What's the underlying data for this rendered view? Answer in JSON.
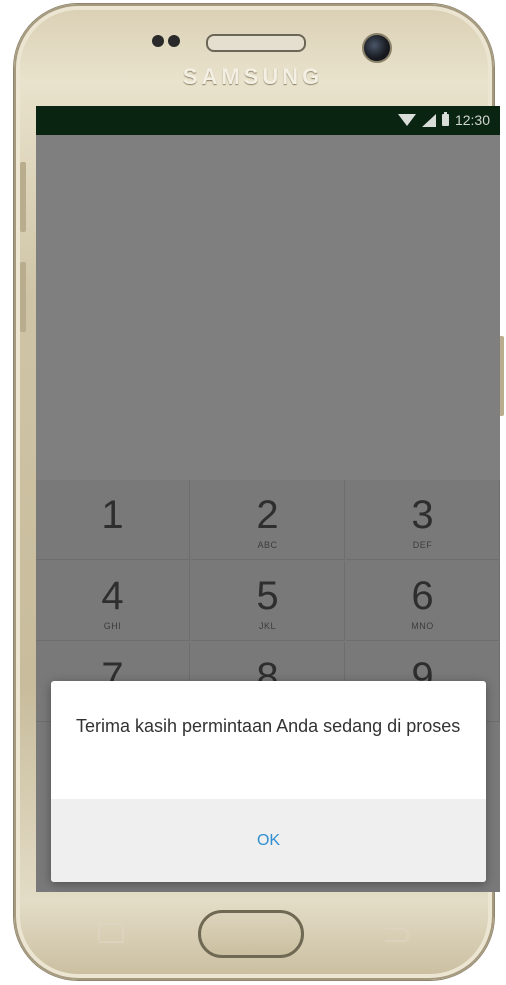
{
  "device": {
    "brand": "SAMSUNG"
  },
  "status_bar": {
    "time": "12:30",
    "icons": [
      "wifi-icon",
      "signal-icon",
      "battery-icon"
    ],
    "background": "#0a2412"
  },
  "keypad": {
    "keys": [
      {
        "digit": "1",
        "letters": ""
      },
      {
        "digit": "2",
        "letters": "ABC"
      },
      {
        "digit": "3",
        "letters": "DEF"
      },
      {
        "digit": "4",
        "letters": "GHI"
      },
      {
        "digit": "5",
        "letters": "JKL"
      },
      {
        "digit": "6",
        "letters": "MNO"
      },
      {
        "digit": "7",
        "letters": ""
      },
      {
        "digit": "8",
        "letters": ""
      },
      {
        "digit": "9",
        "letters": ""
      }
    ]
  },
  "dialog": {
    "message": "Terima kasih permintaan Anda sedang di proses",
    "ok_label": "OK",
    "accent": "#2f8fd0"
  }
}
